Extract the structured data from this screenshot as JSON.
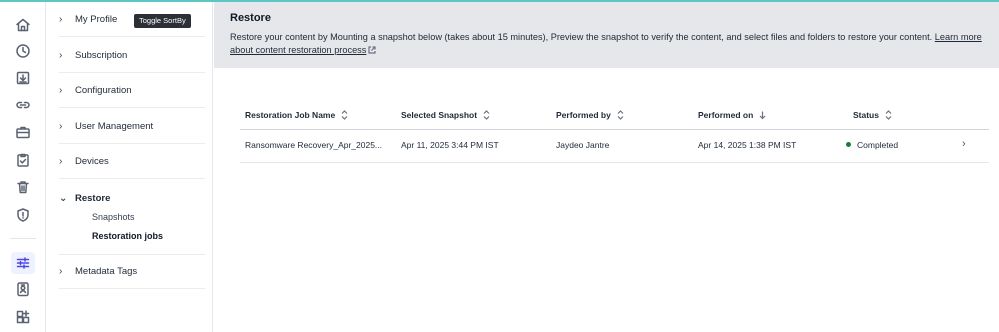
{
  "rail": {
    "icons": [
      "home-icon",
      "clock-icon",
      "download-box-icon",
      "link-icon",
      "briefcase-icon",
      "clipboard-check-icon",
      "trash-icon",
      "shield-alert-icon",
      "sliders-icon",
      "id-badge-icon",
      "apps-add-icon"
    ],
    "active": "sliders-icon",
    "active_color": "#4f46e5"
  },
  "sidebar": {
    "items": [
      {
        "label": "My Profile",
        "chevron": ">"
      },
      {
        "label": "Subscription",
        "chevron": ">"
      },
      {
        "label": "Configuration",
        "chevron": ">"
      },
      {
        "label": "User Management",
        "chevron": ">"
      },
      {
        "label": "Devices",
        "chevron": ">"
      },
      {
        "label": "Restore",
        "chevron": "v"
      },
      {
        "label": "Metadata Tags",
        "chevron": ">"
      }
    ],
    "restore_sub": [
      "Snapshots",
      "Restoration jobs"
    ],
    "active_sub": "Restoration jobs"
  },
  "tooltip": {
    "text": "Toggle SortBy"
  },
  "banner": {
    "title": "Restore",
    "description": "Restore your content by Mounting a snapshot below (takes about 15 minutes), Preview the snapshot to verify the content, and select files and folders to restore your content.",
    "link_text": "Learn more about content restoration process",
    "background": "#e6e7ea"
  },
  "table": {
    "columns": [
      {
        "label": "Restoration Job Name",
        "sort": "both"
      },
      {
        "label": "Selected Snapshot",
        "sort": "both"
      },
      {
        "label": "Performed by",
        "sort": "both"
      },
      {
        "label": "Performed on",
        "sort": "desc"
      },
      {
        "label": "Status",
        "sort": "both"
      }
    ],
    "rows": [
      {
        "job_name": "Ransomware Recovery_Apr_2025...",
        "snapshot": "Apr 11, 2025 3:44 PM IST",
        "performed_by": "Jaydeo Jantre",
        "performed_on": "Apr 14, 2025 1:38 PM IST",
        "status": "Completed",
        "status_color": "#15803d"
      }
    ]
  }
}
